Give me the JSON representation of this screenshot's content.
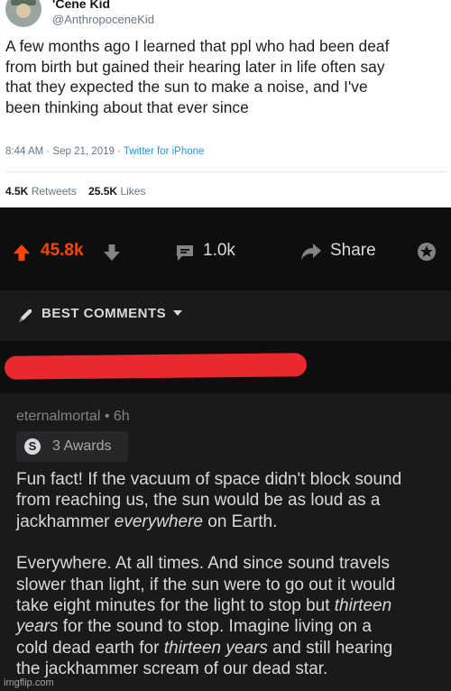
{
  "tweet": {
    "display_name": "'Cene Kid",
    "handle": "@AnthropoceneKid",
    "text_lines": [
      "A few months ago I learned that ppl who had been deaf",
      "from birth but gained their hearing later in life often say",
      "that they expected the sun to make a noise, and I've",
      "been thinking about that ever since"
    ],
    "time": "8:44 AM",
    "date": "Sep 21, 2019",
    "separator": "·",
    "source": "Twitter for iPhone",
    "retweets": "4.5K",
    "retweets_label": "Retweets",
    "likes": "25.5K",
    "likes_label": "Likes"
  },
  "post_actions": {
    "score": "45.8k",
    "comments": "1.0k",
    "share_label": "Share"
  },
  "sort": {
    "label": "BEST COMMENTS"
  },
  "comment": {
    "author": "eternalmortal",
    "age": "6h",
    "awards_label": "3 Awards",
    "coin_letter": "S",
    "paragraph1": [
      [
        "Fun fact! If the vacuum of space didn't block sound",
        ""
      ],
      [
        "from reaching us, the sun would be as loud as a",
        ""
      ],
      [
        "jackhammer ",
        "everywhere",
        " on Earth."
      ]
    ],
    "paragraph2": [
      [
        "Everywhere. At all times. And since sound travels",
        ""
      ],
      [
        "slower than light, if the sun were to go out it would",
        ""
      ],
      [
        "take eight minutes for the light to stop but ",
        "thirteen",
        ""
      ],
      [
        "",
        "years",
        " for the sound to stop. Imagine living on a"
      ],
      [
        "cold dead earth for ",
        "thirteen years",
        " and still hearing"
      ],
      [
        "the jackhammer scream of our dead star.",
        ""
      ]
    ]
  },
  "watermark": "imgflip.com",
  "colors": {
    "upvote": "#ff4500",
    "redaction": "#e8292f",
    "twitter_link": "#1b95e0",
    "dark_bg": "#1a1a1b"
  }
}
